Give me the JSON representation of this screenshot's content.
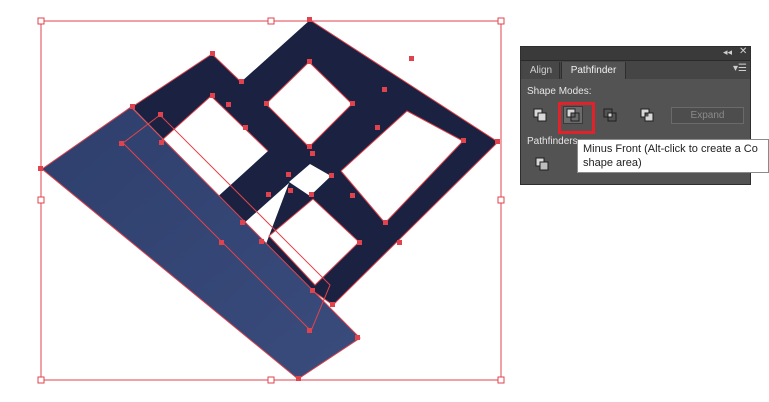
{
  "canvas": {
    "shape_colors": {
      "dark_lattice": "#1b2140",
      "blue_parallelogram": "#344675",
      "selection_outline": "#e0434d",
      "anchor_point": "#e0434d"
    }
  },
  "panel": {
    "titlebar": {
      "collapse_glyph": "◂◂",
      "close_glyph": "✕"
    },
    "tabs": [
      {
        "label": "Align",
        "active": false
      },
      {
        "label": "Pathfinder",
        "active": true
      }
    ],
    "menu_glyph": "▾☰",
    "shape_modes_label": "Shape Modes:",
    "shape_mode_buttons": [
      {
        "icon": "unite-icon"
      },
      {
        "icon": "minus-front-icon",
        "highlighted": true
      },
      {
        "icon": "intersect-icon"
      },
      {
        "icon": "exclude-icon"
      }
    ],
    "expand_label": "Expand",
    "pathfinders_label": "Pathfinders",
    "colors": {
      "panel_bg": "#535353",
      "highlight": "#e0222a"
    }
  },
  "tooltip": {
    "line1": "Minus Front (Alt-click to create a Co",
    "line2": "shape area)"
  }
}
